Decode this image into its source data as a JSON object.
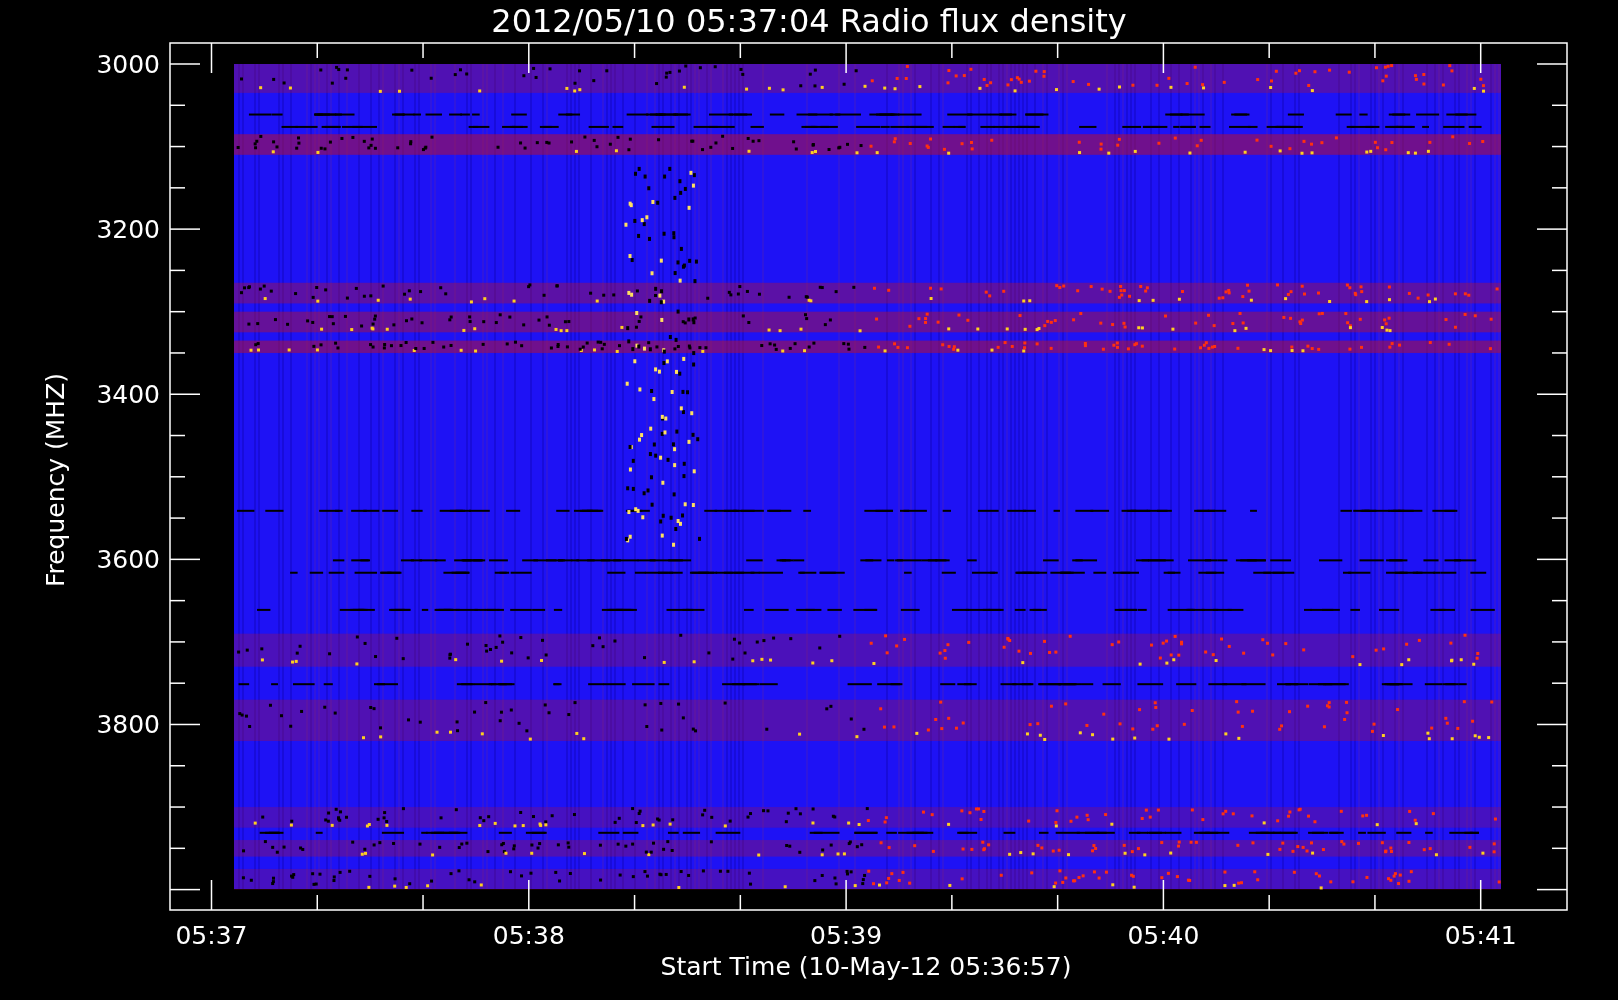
{
  "title": "2012/05/10 05:37:04 Radio flux density",
  "y_axis": {
    "label": "Frequency (MHZ)",
    "ticks": [
      "3000",
      "3200",
      "3400",
      "3600",
      "3800"
    ]
  },
  "x_axis": {
    "label": "Start Time (10-May-12 05:36:57)",
    "ticks": [
      "05:37",
      "05:38",
      "05:39",
      "05:40",
      "05:41"
    ]
  }
}
